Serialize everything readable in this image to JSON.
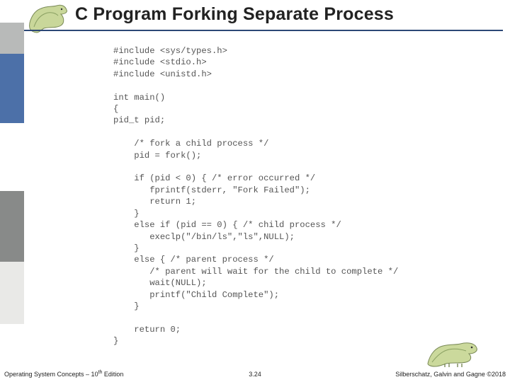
{
  "header": {
    "title": "C Program Forking Separate Process"
  },
  "code": {
    "lines": [
      "#include <sys/types.h>",
      "#include <stdio.h>",
      "#include <unistd.h>",
      "",
      "int main()",
      "{",
      "pid_t pid;",
      "",
      "    /* fork a child process */",
      "    pid = fork();",
      "",
      "    if (pid < 0) { /* error occurred */",
      "       fprintf(stderr, \"Fork Failed\");",
      "       return 1;",
      "    }",
      "    else if (pid == 0) { /* child process */",
      "       execlp(\"/bin/ls\",\"ls\",NULL);",
      "    }",
      "    else { /* parent process */",
      "       /* parent will wait for the child to complete */",
      "       wait(NULL);",
      "       printf(\"Child Complete\");",
      "    }",
      "",
      "    return 0;",
      "}"
    ]
  },
  "footer": {
    "left_prefix": "Operating System Concepts – 10",
    "left_suffix_sup": "th",
    "left_tail": " Edition",
    "center": "3.24",
    "right": "Silberschatz, Galvin and Gagne ©2018"
  },
  "icons": {
    "header_dino": "dinosaur-icon",
    "footer_dino": "dinosaur-icon"
  }
}
